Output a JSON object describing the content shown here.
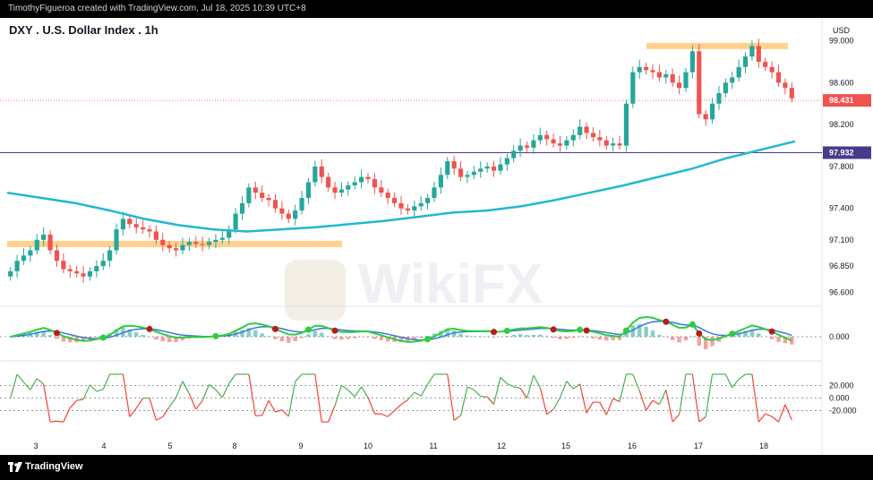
{
  "header": {
    "attribution": "TimothyFigueroa created with TradingView.com, Jul 18, 2025 10:39 UTC+8"
  },
  "footer": {
    "brand": "TradingView"
  },
  "watermark": {
    "text": "WikiFX"
  },
  "colors": {
    "up": "#26a69a",
    "down": "#ef5350",
    "ma": "#22b8cf",
    "zone": "#ffcc80",
    "hline": "#4a3a8a",
    "wave_fast": "#2ecc40",
    "wave_slow": "#3a78d8",
    "wave_slow_down": "#b71c1c",
    "osc_up": "#4caf50",
    "osc_down": "#f44336"
  },
  "chart_data": {
    "type": "candlestick",
    "title": "DXY . U.S. Dollar Index . 1h",
    "currency": "USD",
    "y_ticks": [
      "99.000",
      "98.600",
      "98.200",
      "97.800",
      "97.400",
      "97.100",
      "96.850",
      "96.600"
    ],
    "y_tick_values": [
      99.0,
      98.6,
      98.2,
      97.8,
      97.4,
      97.1,
      96.85,
      96.6
    ],
    "ylim": [
      96.5,
      99.15
    ],
    "x_ticks": [
      "3",
      "4",
      "5",
      "8",
      "9",
      "10",
      "11",
      "12",
      "15",
      "16",
      "17",
      "18"
    ],
    "last_price": {
      "value": 98.431,
      "label": "98.431"
    },
    "horizontal_line": {
      "value": 97.932,
      "label": "97.932"
    },
    "resistance_zone": {
      "from": 98.92,
      "to": 98.98
    },
    "support_zone": {
      "from": 97.03,
      "to": 97.09
    },
    "close_series": [
      96.8,
      96.9,
      96.95,
      97.0,
      97.1,
      97.15,
      97.0,
      96.9,
      96.82,
      96.8,
      96.78,
      96.75,
      96.8,
      96.85,
      96.9,
      97.0,
      97.2,
      97.3,
      97.25,
      97.22,
      97.2,
      97.18,
      97.1,
      97.05,
      97.02,
      97.0,
      97.05,
      97.08,
      97.06,
      97.05,
      97.08,
      97.1,
      97.12,
      97.2,
      97.35,
      97.45,
      97.6,
      97.55,
      97.5,
      97.48,
      97.4,
      97.35,
      97.3,
      97.38,
      97.5,
      97.65,
      97.8,
      97.7,
      97.6,
      97.55,
      97.58,
      97.62,
      97.65,
      97.7,
      97.68,
      97.6,
      97.55,
      97.5,
      97.45,
      97.4,
      97.38,
      97.42,
      97.45,
      97.5,
      97.6,
      97.72,
      97.85,
      97.78,
      97.7,
      97.72,
      97.75,
      97.78,
      97.8,
      97.76,
      97.82,
      97.88,
      97.95,
      98.0,
      97.98,
      98.05,
      98.1,
      98.06,
      98.02,
      98.0,
      98.05,
      98.1,
      98.18,
      98.12,
      98.08,
      98.05,
      98.0,
      98.02,
      98.0,
      98.4,
      98.7,
      98.75,
      98.72,
      98.7,
      98.65,
      98.68,
      98.6,
      98.55,
      98.7,
      98.9,
      98.3,
      98.25,
      98.4,
      98.5,
      98.6,
      98.65,
      98.75,
      98.85,
      98.95,
      98.8,
      98.75,
      98.7,
      98.6,
      98.55,
      98.45
    ],
    "ma_series": [
      97.55,
      97.5,
      97.45,
      97.38,
      97.3,
      97.24,
      97.2,
      97.18,
      97.2,
      97.22,
      97.25,
      97.28,
      97.32,
      97.36,
      97.38,
      97.42,
      97.48,
      97.55,
      97.62,
      97.7,
      97.78,
      97.88,
      97.96,
      98.04
    ],
    "macd_ticks": [
      "0.000"
    ],
    "rsi_ticks": [
      "20.000",
      "0.000",
      "-20.000"
    ]
  }
}
